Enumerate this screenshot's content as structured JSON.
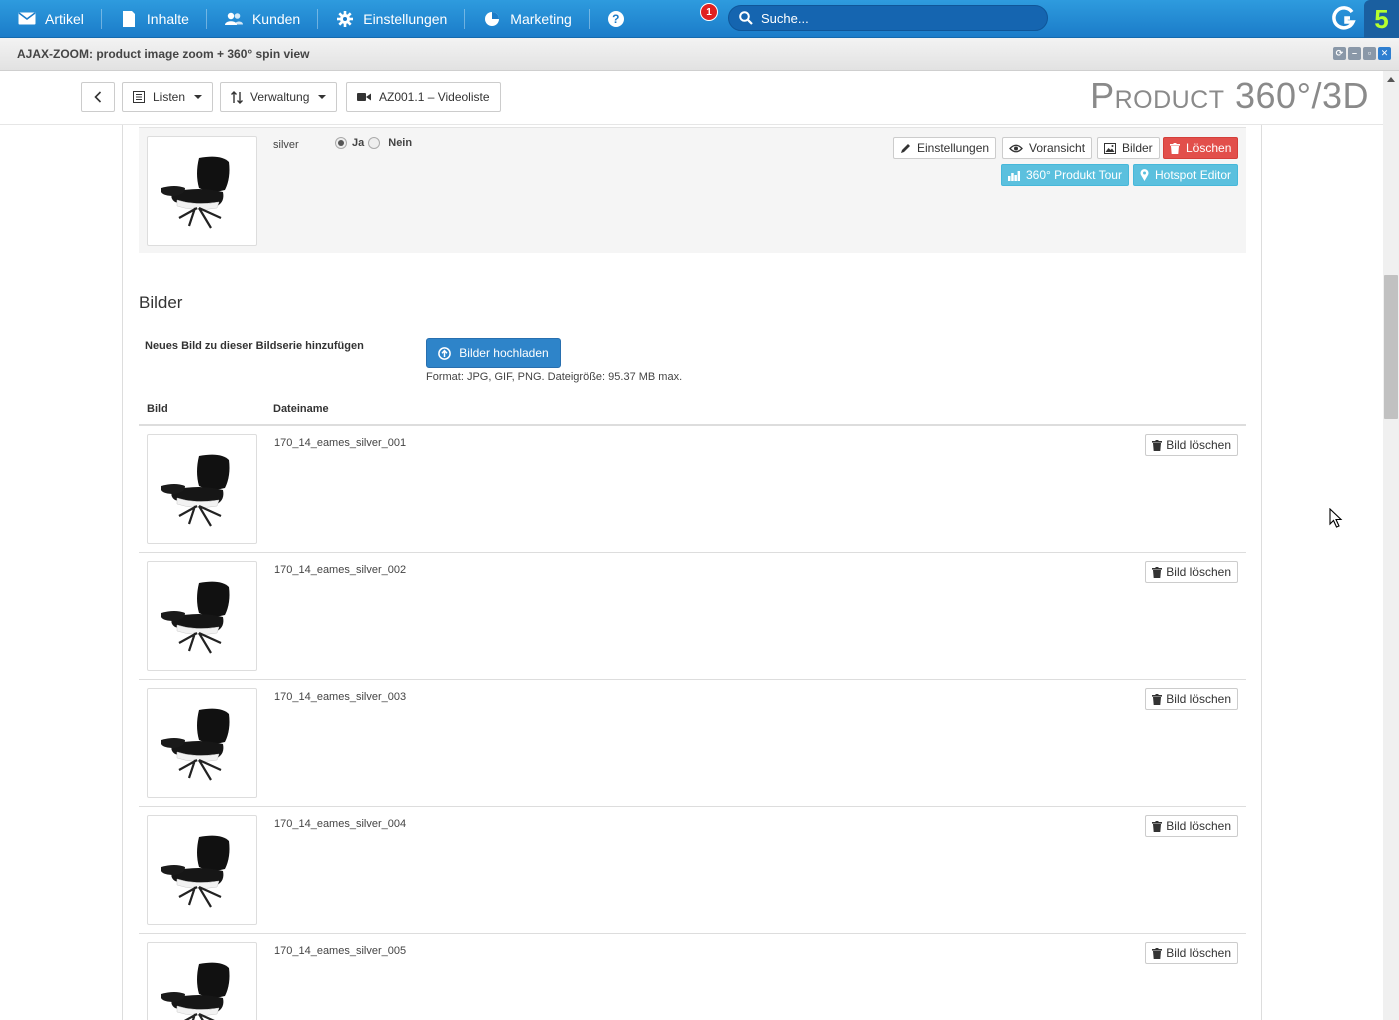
{
  "nav": {
    "items": [
      {
        "label": "Artikel",
        "icon": "envelope-icon"
      },
      {
        "label": "Inhalte",
        "icon": "page-icon"
      },
      {
        "label": "Kunden",
        "icon": "users-icon"
      },
      {
        "label": "Einstellungen",
        "icon": "gear-icon"
      },
      {
        "label": "Marketing",
        "icon": "pie-chart-icon"
      }
    ],
    "help_badge": "1",
    "search_placeholder": "Suche...",
    "brand_number": "5"
  },
  "module": {
    "title": "AJAX-ZOOM: product image zoom + 360° spin view"
  },
  "toolbar": {
    "listen": "Listen",
    "verwaltung": "Verwaltung",
    "videoliste": "AZ001.1 – Videoliste",
    "page_title": "Product 360°/3D"
  },
  "series": {
    "name": "silver",
    "yes": "Ja",
    "no": "Nein",
    "selected": "Ja",
    "buttons": {
      "settings": "Einstellungen",
      "preview": "Voransicht",
      "images": "Bilder",
      "delete": "Löschen",
      "tour": "360° Produkt Tour",
      "hotspot": "Hotspot Editor"
    }
  },
  "images": {
    "heading": "Bilder",
    "add_label": "Neues Bild zu dieser Bildserie hinzufügen",
    "upload_button": "Bilder hochladen",
    "format_hint": "Format: JPG, GIF, PNG. Dateigröße: 95.37 MB max.",
    "columns": [
      "Bild",
      "Dateiname"
    ],
    "delete_label": "Bild löschen",
    "rows": [
      {
        "filename": "170_14_eames_silver_001"
      },
      {
        "filename": "170_14_eames_silver_002"
      },
      {
        "filename": "170_14_eames_silver_003"
      },
      {
        "filename": "170_14_eames_silver_004"
      },
      {
        "filename": "170_14_eames_silver_005"
      }
    ]
  },
  "colors": {
    "nav_blue": "#1b7cc9",
    "primary": "#2e84c9",
    "danger": "#e24f4b",
    "info": "#5bc0de"
  }
}
